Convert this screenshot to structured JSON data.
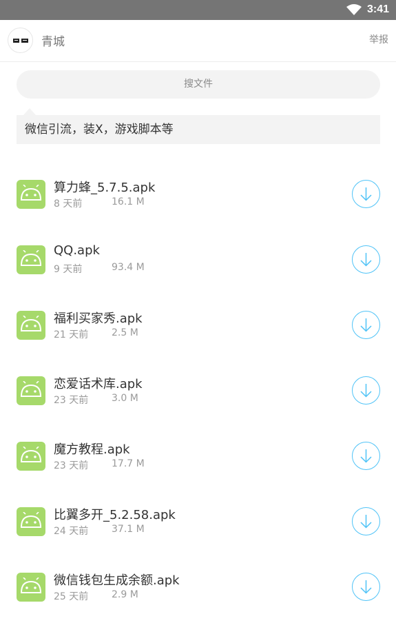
{
  "status_bar": {
    "time": "3:41",
    "wifi_icon": "wifi-icon"
  },
  "header": {
    "name": "青城",
    "report_label": "举报",
    "avatar_icon": "qingcheng-logo"
  },
  "search": {
    "placeholder": "搜文件"
  },
  "notice": {
    "text": "微信引流，装X，游戏脚本等"
  },
  "colors": {
    "accent": "#4fc3f7",
    "icon_green": "#a6d96a",
    "status_bar": "#757575"
  },
  "files": [
    {
      "name": "算力蜂_5.7.5.apk",
      "date": "8 天前",
      "size": "16.1 M",
      "icon": "android-icon"
    },
    {
      "name": "QQ.apk",
      "date": "9 天前",
      "size": "93.4 M",
      "icon": "android-icon"
    },
    {
      "name": "福利买家秀.apk",
      "date": "21 天前",
      "size": "2.5 M",
      "icon": "android-icon"
    },
    {
      "name": "恋爱话术库.apk",
      "date": "23 天前",
      "size": "3.0 M",
      "icon": "android-icon"
    },
    {
      "name": "魔方教程.apk",
      "date": "23 天前",
      "size": "17.7 M",
      "icon": "android-icon"
    },
    {
      "name": "比翼多开_5.2.58.apk",
      "date": "24 天前",
      "size": "37.1 M",
      "icon": "android-icon"
    },
    {
      "name": "微信钱包生成余额.apk",
      "date": "25 天前",
      "size": "2.9 M",
      "icon": "android-icon"
    }
  ]
}
